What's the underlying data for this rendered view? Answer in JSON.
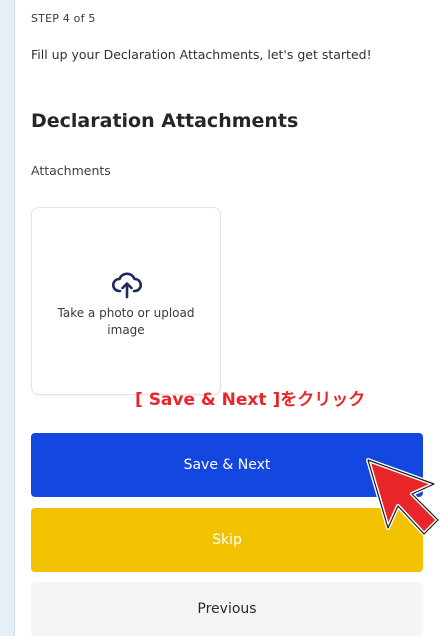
{
  "step": "STEP 4 of 5",
  "intro": "Fill up your Declaration Attachments, let's get started!",
  "heading": "Declaration Attachments",
  "section_label": "Attachments",
  "upload": {
    "icon": "cloud-upload-icon",
    "text": "Take a photo or upload image"
  },
  "callout": "[ Save & Next ]をクリック",
  "buttons": {
    "save_next": "Save & Next",
    "skip": "Skip",
    "previous": "Previous"
  },
  "colors": {
    "primary": "#1447e0",
    "skip": "#f2c200",
    "callout": "#e8262a"
  }
}
